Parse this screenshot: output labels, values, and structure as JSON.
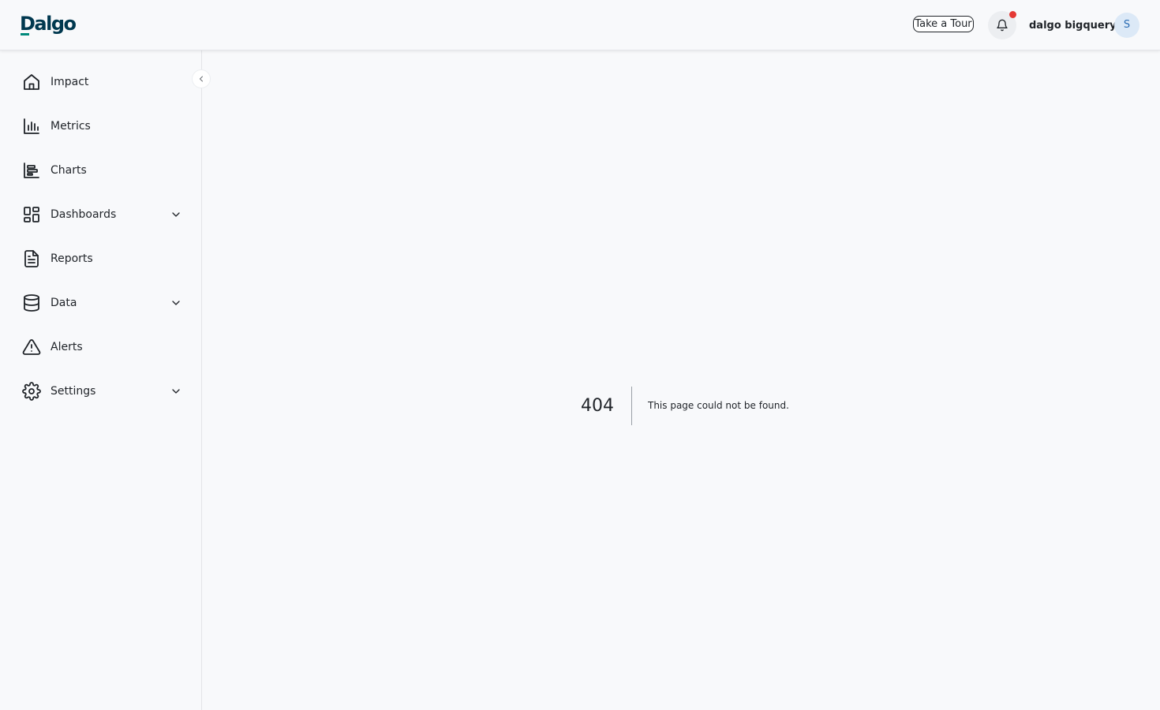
{
  "header": {
    "logo_text": "Dalgo",
    "tour_label": "Take a Tour",
    "username": "dalgo bigquery",
    "avatar_initial": "S",
    "notification_icon": "bell-icon",
    "notification_dot_color": "#e53935",
    "brand_color": "#00384f",
    "accent_color": "#00897b"
  },
  "sidebar": {
    "items": [
      {
        "label": "Impact",
        "icon": "home-icon",
        "expandable": false
      },
      {
        "label": "Metrics",
        "icon": "bar-chart-icon",
        "expandable": false
      },
      {
        "label": "Charts",
        "icon": "chart-icon",
        "expandable": false
      },
      {
        "label": "Dashboards",
        "icon": "dashboard-grid-icon",
        "expandable": true
      },
      {
        "label": "Reports",
        "icon": "report-document-icon",
        "expandable": false
      },
      {
        "label": "Data",
        "icon": "database-icon",
        "expandable": true
      },
      {
        "label": "Alerts",
        "icon": "alert-triangle-icon",
        "expandable": false
      },
      {
        "label": "Settings",
        "icon": "gear-icon",
        "expandable": true
      }
    ],
    "collapse_icon": "chevron-left-icon"
  },
  "main": {
    "error_code": "404",
    "error_message": "This page could not be found."
  }
}
